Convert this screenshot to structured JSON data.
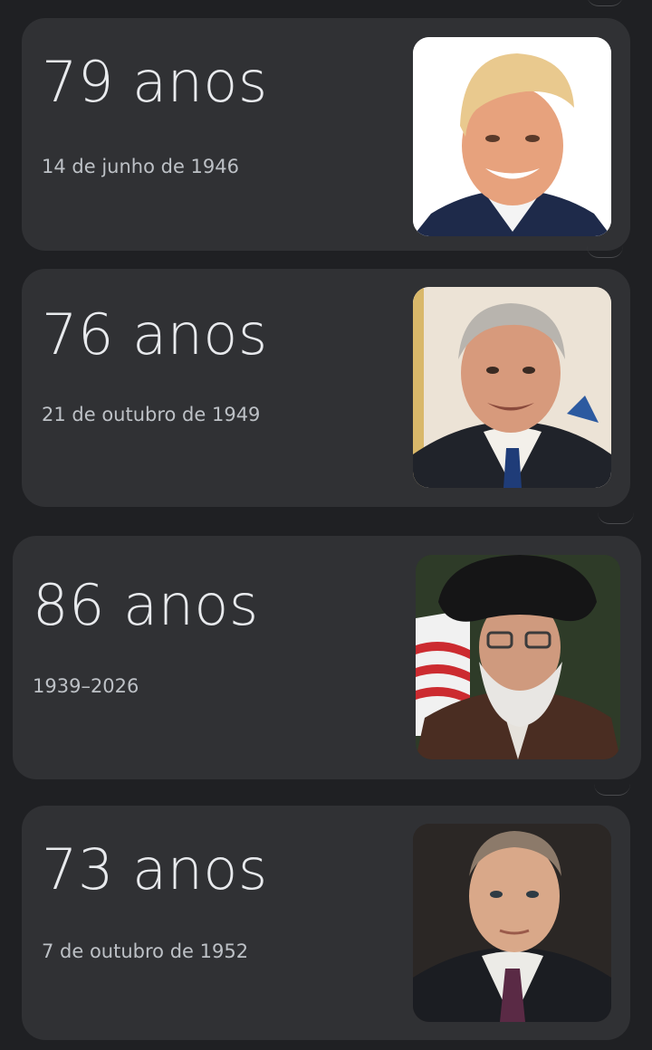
{
  "cards": [
    {
      "age": "79 anos",
      "date": "14 de junho de 1946",
      "photo_icon": "person-portrait-icon"
    },
    {
      "age": "76 anos",
      "date": "21 de outubro de 1949",
      "photo_icon": "person-portrait-icon"
    },
    {
      "age": "86 anos",
      "date": "1939–2026",
      "photo_icon": "person-portrait-icon"
    },
    {
      "age": "73 anos",
      "date": "7 de outubro de 1952",
      "photo_icon": "person-portrait-icon"
    }
  ],
  "colors": {
    "background": "#1f2023",
    "card": "#303134",
    "age_text": "#e8eaed",
    "date_text": "#bdc1c6"
  }
}
